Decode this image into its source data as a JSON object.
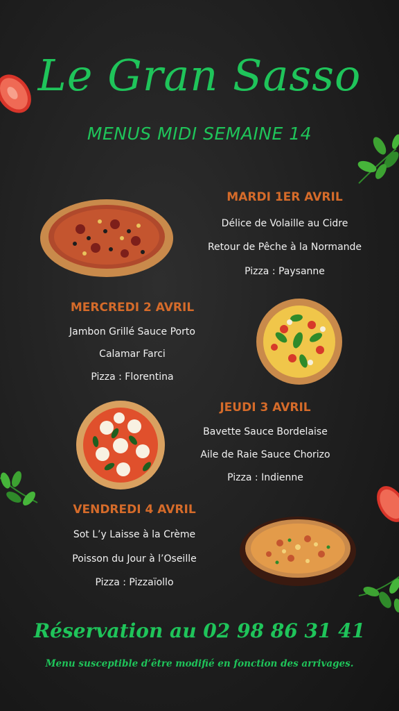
{
  "header": {
    "title": "Le Gran Sasso",
    "subtitle": "MENUS MIDI SEMAINE 14"
  },
  "days": [
    {
      "day": "MARDI 1ER AVRIL",
      "dishes": [
        "Délice de Volaille au Cidre",
        "Retour de Pêche à la Normande",
        "Pizza : Paysanne"
      ]
    },
    {
      "day": "MERCREDI 2 AVRIL",
      "dishes": [
        "Jambon Grillé Sauce Porto",
        "Calamar Farci",
        "Pizza : Florentina"
      ]
    },
    {
      "day": "JEUDI 3 AVRIL",
      "dishes": [
        "Bavette Sauce Bordelaise",
        "Aile de Raie Sauce Chorizo",
        "Pizza : Indienne"
      ]
    },
    {
      "day": "VENDREDI 4 AVRIL",
      "dishes": [
        "Sot L’y Laisse à la Crème",
        "Poisson du Jour à l’Oseille",
        "Pizza : Pizzaïollo"
      ]
    }
  ],
  "footer": {
    "reservation": "Réservation au 02 98 86 31 41",
    "note": "Menu susceptible d’être modifié en fonction des arrivages."
  },
  "decor": {
    "icons": [
      "tomato-slice-icon",
      "basil-leaves-icon",
      "pizza-image"
    ],
    "colors": {
      "accent_green": "#1fc45a",
      "day_orange": "#d56b2a",
      "background": "#1f1f1f"
    }
  }
}
